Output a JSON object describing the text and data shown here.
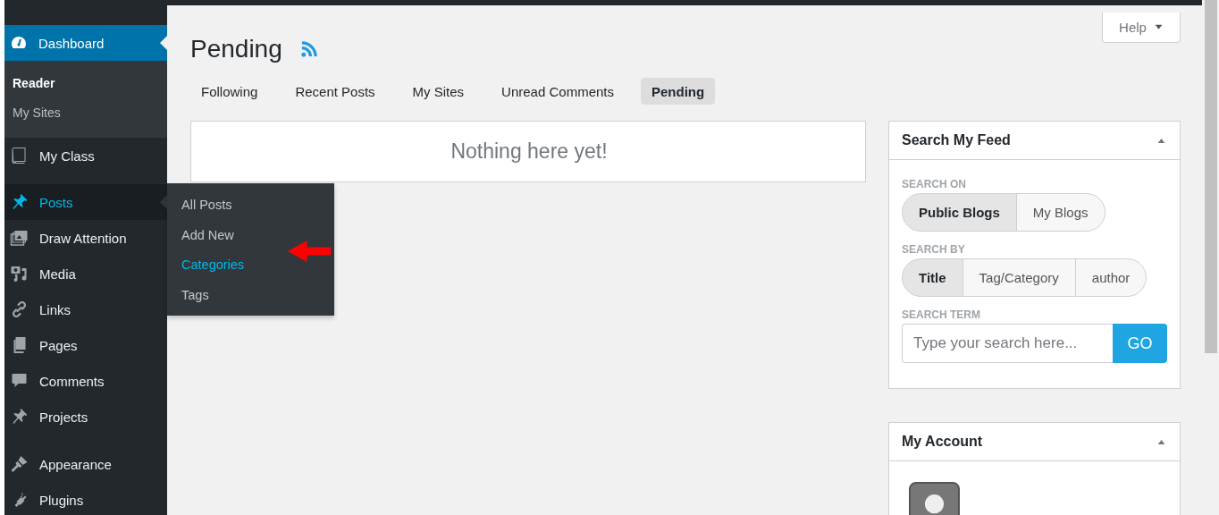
{
  "sidebar": {
    "items": [
      {
        "label": "Dashboard",
        "current": true,
        "open": false,
        "submenu": [
          {
            "label": "Reader",
            "current": true
          },
          {
            "label": "My Sites",
            "current": false
          }
        ]
      },
      {
        "label": "My Class",
        "current": false,
        "open": false
      },
      {
        "label": "Posts",
        "current": false,
        "open": true,
        "flyout": [
          {
            "label": "All Posts",
            "highlighted": false
          },
          {
            "label": "Add New",
            "highlighted": false
          },
          {
            "label": "Categories",
            "highlighted": true
          },
          {
            "label": "Tags",
            "highlighted": false
          }
        ]
      },
      {
        "label": "Draw Attention",
        "current": false,
        "open": false
      },
      {
        "label": "Media",
        "current": false,
        "open": false
      },
      {
        "label": "Links",
        "current": false,
        "open": false
      },
      {
        "label": "Pages",
        "current": false,
        "open": false
      },
      {
        "label": "Comments",
        "current": false,
        "open": false
      },
      {
        "label": "Projects",
        "current": false,
        "open": false
      },
      {
        "label": "Appearance",
        "current": false,
        "open": false
      },
      {
        "label": "Plugins",
        "current": false,
        "open": false
      }
    ]
  },
  "help_button": {
    "label": "Help",
    "expanded": false
  },
  "page_title": "Pending",
  "tabs": [
    {
      "label": "Following",
      "selected": false
    },
    {
      "label": "Recent Posts",
      "selected": false
    },
    {
      "label": "My Sites",
      "selected": false
    },
    {
      "label": "Unread Comments",
      "selected": false
    },
    {
      "label": "Pending",
      "selected": true
    }
  ],
  "empty_message": "Nothing here yet!",
  "search_panel": {
    "title": "Search My Feed",
    "expanded": true,
    "groups": [
      {
        "label": "SEARCH ON",
        "options": [
          {
            "label": "Public Blogs",
            "selected": true
          },
          {
            "label": "My Blogs",
            "selected": false
          }
        ]
      },
      {
        "label": "SEARCH BY",
        "options": [
          {
            "label": "Title",
            "selected": true
          },
          {
            "label": "Tag/Category",
            "selected": false
          },
          {
            "label": "author",
            "selected": false
          }
        ]
      }
    ],
    "term_label": "SEARCH TERM",
    "placeholder": "Type your search here...",
    "button": "GO"
  },
  "account_panel": {
    "title": "My Account",
    "expanded": true
  }
}
